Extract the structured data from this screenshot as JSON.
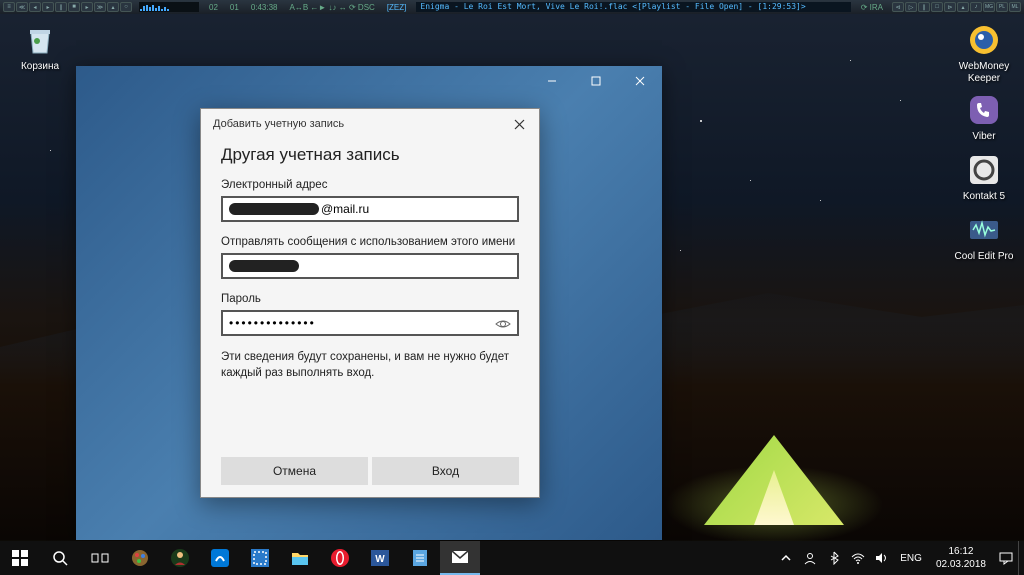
{
  "player": {
    "track_number": "02",
    "subtrack": "01",
    "time": "0:43:38",
    "indicators": "A↔B ←► ↓♪ ↔ ⟳ DSC",
    "fmt": "[ZEZ]",
    "now_playing": "Enigma - Le Roi Est Mort, Vive Le Roi!.flac   <[Playlist - File Open] - [1:29:53]>",
    "rate": "⟳ IRA"
  },
  "desktop_icons": {
    "recycle": "Корзина",
    "webmoney": "WebMoney Keeper",
    "viber": "Viber",
    "kontakt": "Kontakt 5",
    "cooledit": "Cool Edit Pro"
  },
  "dialog": {
    "header": "Добавить учетную запись",
    "title": "Другая учетная запись",
    "email_label": "Электронный адрес",
    "email_domain": "@mail.ru",
    "name_label": "Отправлять сообщения с использованием этого имени",
    "password_label": "Пароль",
    "password_value": "••••••••••••••",
    "hint": "Эти сведения будут сохранены, и вам не нужно будет каждый раз выполнять вход.",
    "cancel": "Отмена",
    "submit": "Вход"
  },
  "taskbar": {
    "lang": "ENG",
    "time": "16:12",
    "date": "02.03.2018"
  }
}
